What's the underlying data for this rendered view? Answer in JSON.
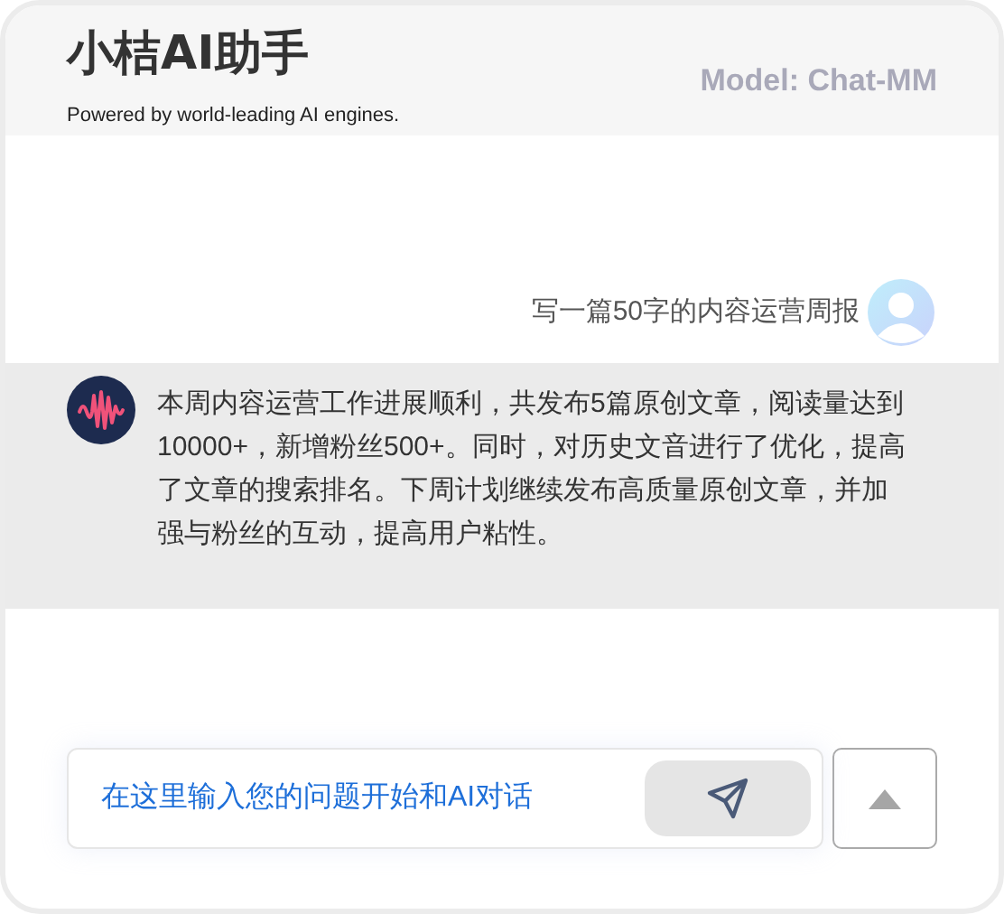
{
  "header": {
    "title": "小桔AI助手",
    "subtitle": "Powered by world-leading AI engines.",
    "model": "Model: Chat-MM"
  },
  "messages": [
    {
      "kind": "user",
      "text": "写一篇50字的内容运营周报"
    },
    {
      "kind": "assistant",
      "text": "本周内容运营工作进展顺利，共发布5篇原创文章，阅读量达到10000+，新增粉丝500+。同时，对历史文音进行了优化，提高了文章的搜索排名。下周计划继续发布高质量原创文章，并加强与粉丝的互动，提高用户粘性。"
    }
  ],
  "input": {
    "placeholder": "在这里输入您的问题开始和AI对话"
  }
}
